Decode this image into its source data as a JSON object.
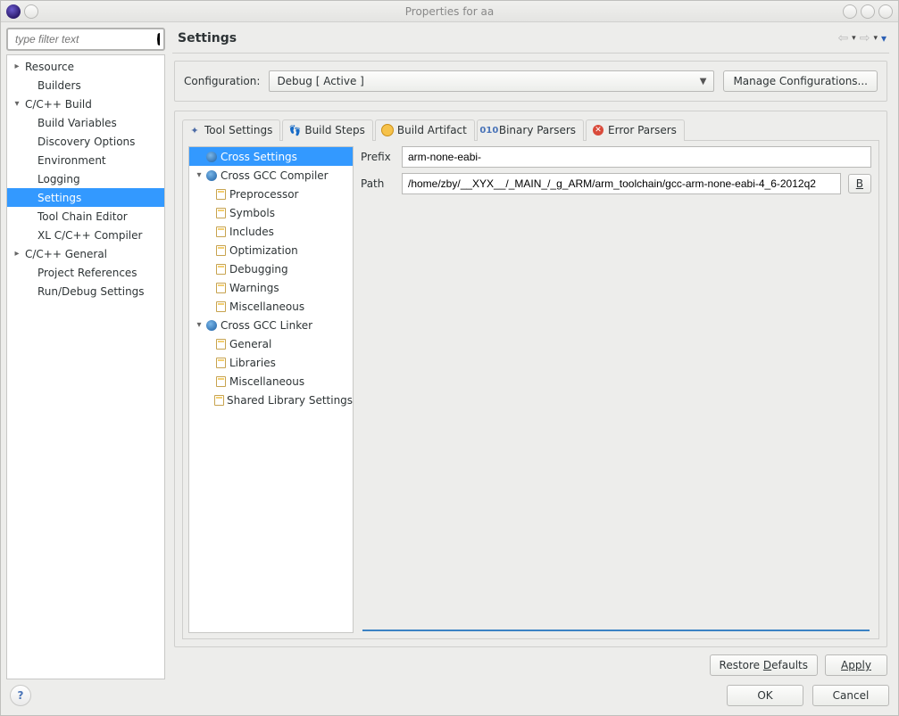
{
  "window": {
    "title": "Properties for aa"
  },
  "filter": {
    "placeholder": "type filter text"
  },
  "leftTree": {
    "resource": "Resource",
    "builders": "Builders",
    "ccbuild": "C/C++ Build",
    "buildVars": "Build Variables",
    "discovery": "Discovery Options",
    "environment": "Environment",
    "logging": "Logging",
    "settings": "Settings",
    "toolchain": "Tool Chain Editor",
    "xlc": "XL C/C++ Compiler",
    "ccgeneral": "C/C++ General",
    "projrefs": "Project References",
    "rundebug": "Run/Debug Settings"
  },
  "header": {
    "title": "Settings"
  },
  "config": {
    "label": "Configuration:",
    "selected": "Debug  [ Active ]",
    "manage": "Manage Configurations..."
  },
  "tabs": {
    "toolSettings": "Tool Settings",
    "buildSteps": "Build Steps",
    "buildArtifact": "Build Artifact",
    "binaryParsers": "Binary Parsers",
    "errorParsers": "Error Parsers"
  },
  "toolTree": {
    "crossSettings": "Cross Settings",
    "crossGccCompiler": "Cross GCC Compiler",
    "preprocessor": "Preprocessor",
    "symbols": "Symbols",
    "includes": "Includes",
    "optimization": "Optimization",
    "debugging": "Debugging",
    "warnings": "Warnings",
    "miscCompiler": "Miscellaneous",
    "crossGccLinker": "Cross GCC Linker",
    "general": "General",
    "libraries": "Libraries",
    "miscLinker": "Miscellaneous",
    "sharedLib": "Shared Library Settings"
  },
  "form": {
    "prefixLabel": "Prefix",
    "prefixValue": "arm-none-eabi-",
    "pathLabel": "Path",
    "pathValue": "/home/zby/__XYX__/_MAIN_/_g_ARM/arm_toolchain/gcc-arm-none-eabi-4_6-2012q2",
    "browse": "B"
  },
  "buttons": {
    "restore": "Restore Defaults",
    "apply": "Apply",
    "ok": "OK",
    "cancel": "Cancel"
  }
}
